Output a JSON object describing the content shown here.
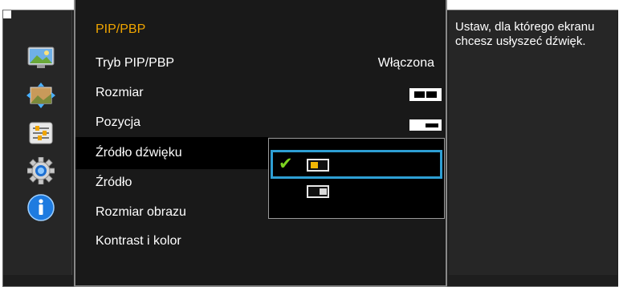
{
  "menu": {
    "title": "PIP/PBP",
    "items": [
      {
        "label": "Tryb PIP/PBP",
        "value": "Włączona"
      },
      {
        "label": "Rozmiar"
      },
      {
        "label": "Pozycja"
      },
      {
        "label": "Źródło dźwięku"
      },
      {
        "label": "Źródło"
      },
      {
        "label": "Rozmiar obrazu"
      },
      {
        "label": "Kontrast i kolor"
      }
    ]
  },
  "help": {
    "text": "Ustaw, dla którego ekranu chcesz usłyszeć dźwięk."
  },
  "submenu": {
    "options": [
      {
        "icon": "main-screen-icon",
        "selected": true
      },
      {
        "icon": "sub-screen-icon",
        "selected": false
      }
    ]
  },
  "sidebar_icons": [
    "picture-icon",
    "screen-adjust-icon",
    "settings-sliders-icon",
    "gear-icon",
    "info-icon"
  ],
  "colors": {
    "accent_title": "#f0a500",
    "selection_border": "#2e9fd4",
    "check": "#7cd320",
    "selected_fill": "#f2b705"
  }
}
